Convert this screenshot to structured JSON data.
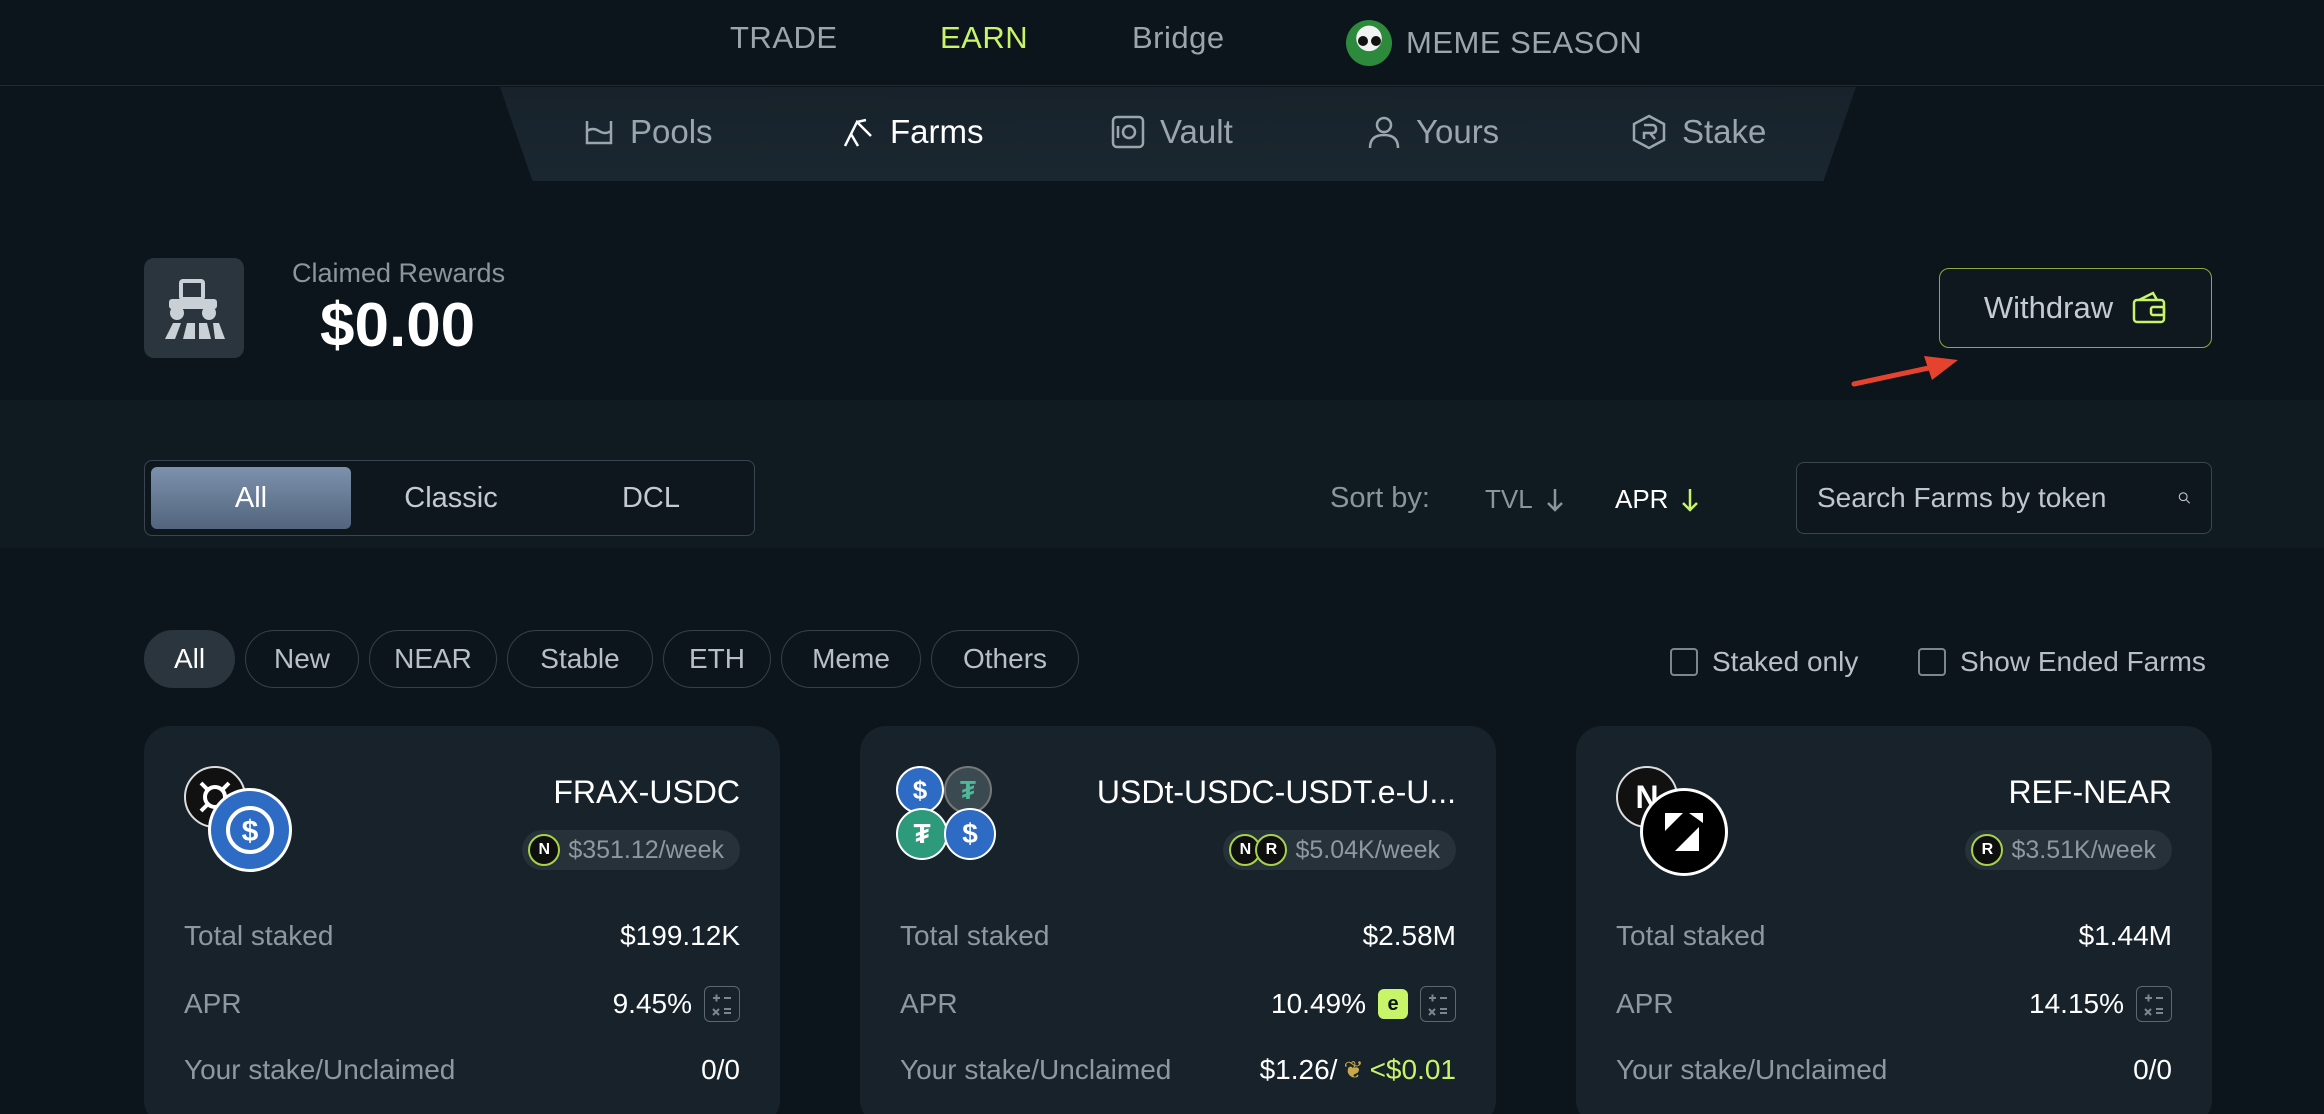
{
  "topnav": {
    "trade": "TRADE",
    "earn": "EARN",
    "bridge": "Bridge",
    "meme": "MEME SEASON"
  },
  "subnav": {
    "pools": "Pools",
    "farms": "Farms",
    "vault": "Vault",
    "yours": "Yours",
    "stake": "Stake"
  },
  "rewards": {
    "label": "Claimed Rewards",
    "value": "$0.00",
    "withdraw": "Withdraw"
  },
  "filters": {
    "types": [
      "All",
      "Classic",
      "DCL"
    ],
    "sort_label": "Sort by:",
    "sort_tvl": "TVL",
    "sort_apr": "APR",
    "search_placeholder": "Search Farms by token",
    "categories": [
      "All",
      "New",
      "NEAR",
      "Stable",
      "ETH",
      "Meme",
      "Others"
    ],
    "staked_only": "Staked only",
    "show_ended": "Show Ended Farms"
  },
  "cards": [
    {
      "title": "FRAX-USDC",
      "reward": "$351.12/week",
      "total_staked_label": "Total staked",
      "total_staked": "$199.12K",
      "apr_label": "APR",
      "apr": "9.45%",
      "stake_label": "Your stake/Unclaimed",
      "stake": "0/0"
    },
    {
      "title": "USDt-USDC-USDT.e-U...",
      "reward": "$5.04K/week",
      "total_staked_label": "Total staked",
      "total_staked": "$2.58M",
      "apr_label": "APR",
      "apr": "10.49%",
      "stake_label": "Your stake/Unclaimed",
      "stake": "$1.26/",
      "unclaimed": "<$0.01"
    },
    {
      "title": "REF-NEAR",
      "reward": "$3.51K/week",
      "total_staked_label": "Total staked",
      "total_staked": "$1.44M",
      "apr_label": "APR",
      "apr": "14.15%",
      "stake_label": "Your stake/Unclaimed",
      "stake": "0/0"
    }
  ],
  "colors": {
    "accent": "#c8f46a",
    "background": "#0c151c",
    "card": "#17222b",
    "annotation_arrow": "#e5432f"
  }
}
